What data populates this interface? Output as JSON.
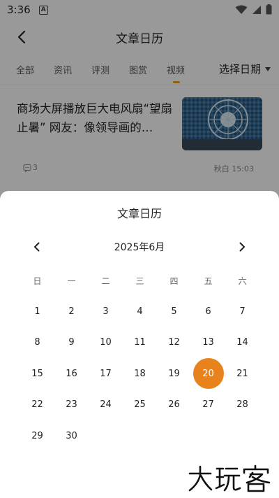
{
  "status_bar": {
    "time": "3:36",
    "notification_badge": "A"
  },
  "header": {
    "title": "文章日历"
  },
  "tabs": [
    {
      "label": "全部"
    },
    {
      "label": "资讯"
    },
    {
      "label": "评测"
    },
    {
      "label": "图赏"
    },
    {
      "label": "视频"
    }
  ],
  "date_picker": {
    "label": "选择日期"
  },
  "article": {
    "title": "商场大屏播放巨大电风扇“望扇止暑” 网友：像领导画的…",
    "comment_count": "3",
    "author_time": "秋白 15:03"
  },
  "calendar": {
    "title": "文章日历",
    "month_label": "2025年6月",
    "weekdays": [
      "日",
      "一",
      "二",
      "三",
      "四",
      "五",
      "六"
    ],
    "days": [
      "1",
      "2",
      "3",
      "4",
      "5",
      "6",
      "7",
      "8",
      "9",
      "10",
      "11",
      "12",
      "13",
      "14",
      "15",
      "16",
      "17",
      "18",
      "19",
      "20",
      "21",
      "22",
      "23",
      "24",
      "25",
      "26",
      "27",
      "28",
      "29",
      "30"
    ],
    "first_weekday_index": 0,
    "selected_day": "20",
    "accent_color": "#e8821c"
  },
  "watermark": {
    "text": "大玩客"
  }
}
